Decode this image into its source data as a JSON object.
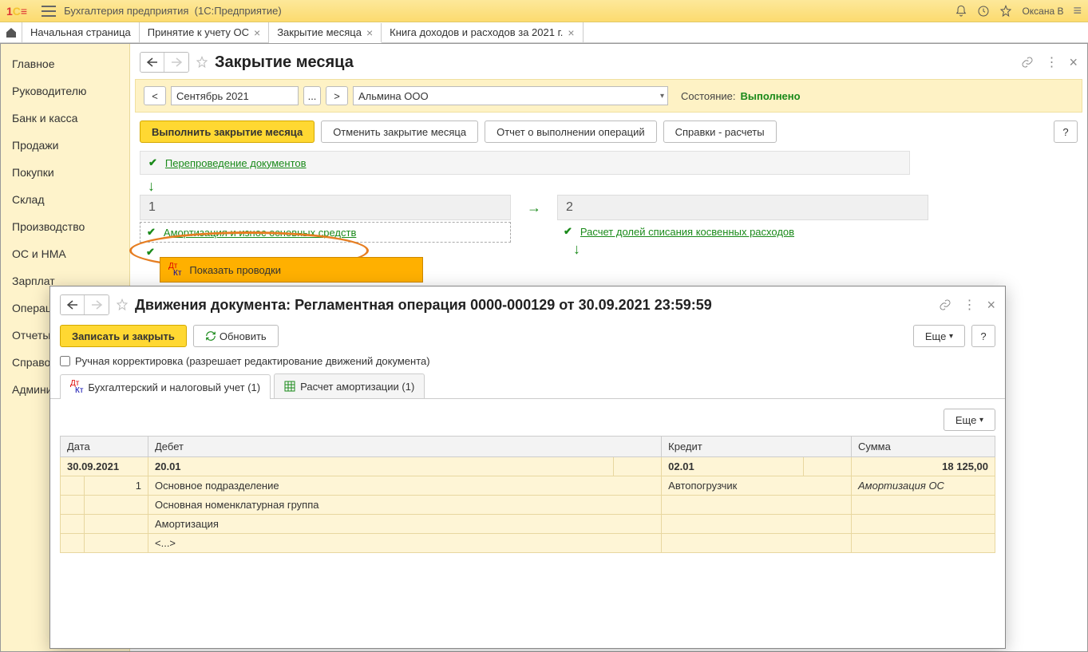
{
  "titlebar": {
    "app": "Бухгалтерия предприятия",
    "platform": "(1С:Предприятие)",
    "user": "Оксана В"
  },
  "tabs": {
    "home": "Начальная страница",
    "items": [
      {
        "label": "Принятие к учету ОС"
      },
      {
        "label": "Закрытие месяца",
        "active": true
      },
      {
        "label": "Книга доходов и расходов за 2021 г."
      }
    ]
  },
  "sidebar": {
    "items": [
      "Главное",
      "Руководителю",
      "Банк и касса",
      "Продажи",
      "Покупки",
      "Склад",
      "Производство",
      "ОС и НМА",
      "Зарплат",
      "Операци",
      "Отчеты",
      "Справоч",
      "Админи"
    ]
  },
  "form": {
    "title": "Закрытие месяца",
    "month": "Сентябрь 2021",
    "dots": "...",
    "org": "Альмина ООО",
    "status_label": "Состояние:",
    "status_value": "Выполнено",
    "buttons": {
      "execute": "Выполнить закрытие месяца",
      "cancel": "Отменить закрытие месяца",
      "report": "Отчет о выполнении операций",
      "calcs": "Справки - расчеты",
      "help": "?"
    },
    "ops": {
      "redo": "Перепроведение документов",
      "step1": "1",
      "step2": "2",
      "op1": "Амортизация и износ основных средств",
      "op2": "Расчет долей списания косвенных расходов",
      "context_item": "Показать проводки"
    }
  },
  "modal": {
    "title": "Движения документа: Регламентная операция 0000-000129 от 30.09.2021 23:59:59",
    "buttons": {
      "save": "Записать и закрыть",
      "refresh": "Обновить",
      "more": "Еще",
      "help": "?"
    },
    "checkbox": "Ручная корректировка (разрешает редактирование движений документа)",
    "tabs": {
      "accounting": "Бухгалтерский и налоговый учет (1)",
      "amort": "Расчет амортизации (1)"
    },
    "table": {
      "headers": {
        "date": "Дата",
        "debit": "Дебет",
        "credit": "Кредит",
        "sum": "Сумма"
      },
      "row": {
        "date": "30.09.2021",
        "debit_acc": "20.01",
        "credit_acc": "02.01",
        "amount": "18 125,00",
        "num": "1",
        "debit_sub1": "Основное подразделение",
        "debit_sub2": "Основная номенклатурная группа",
        "debit_sub3": "Амортизация",
        "debit_sub4": "<...>",
        "credit_sub1": "Автопогрузчик",
        "desc": "Амортизация ОС"
      }
    }
  }
}
